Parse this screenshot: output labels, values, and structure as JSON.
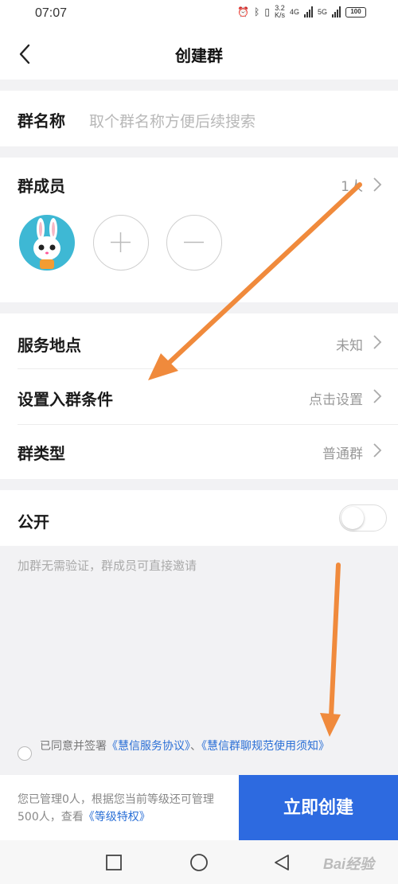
{
  "status_bar": {
    "time": "07:07",
    "speed": "3.2",
    "speed_unit": "K/s",
    "net1": "4G",
    "net2": "5G",
    "battery": "100"
  },
  "navbar": {
    "title": "创建群",
    "back_icon": "chevron-left-icon"
  },
  "group_name": {
    "label": "群名称",
    "placeholder": "取个群名称方便后续搜索"
  },
  "members": {
    "label": "群成员",
    "count": "1人",
    "add_icon": "plus-icon",
    "remove_icon": "minus-icon"
  },
  "settings": [
    {
      "label": "服务地点",
      "value": "未知"
    },
    {
      "label": "设置入群条件",
      "value": "点击设置"
    },
    {
      "label": "群类型",
      "value": "普通群"
    }
  ],
  "public": {
    "label": "公开",
    "enabled": false,
    "hint": "加群无需验证，群成员可直接邀请"
  },
  "agreement": {
    "prefix": "已同意并签署",
    "link1": "《慧信服务协议》",
    "sep": "、",
    "link2": "《慧信群聊规范使用须知》"
  },
  "footer": {
    "info": "您已管理0人，根据您当前等级还可管理500人，查看",
    "link": "《等级特权》",
    "create_button": "立即创建"
  },
  "watermark": "Bai经验",
  "colors": {
    "accent": "#2d6ae0",
    "link": "#2a6fd6",
    "annotation_arrow": "#f08a3c",
    "avatar_bg": "#3eb8d4"
  }
}
